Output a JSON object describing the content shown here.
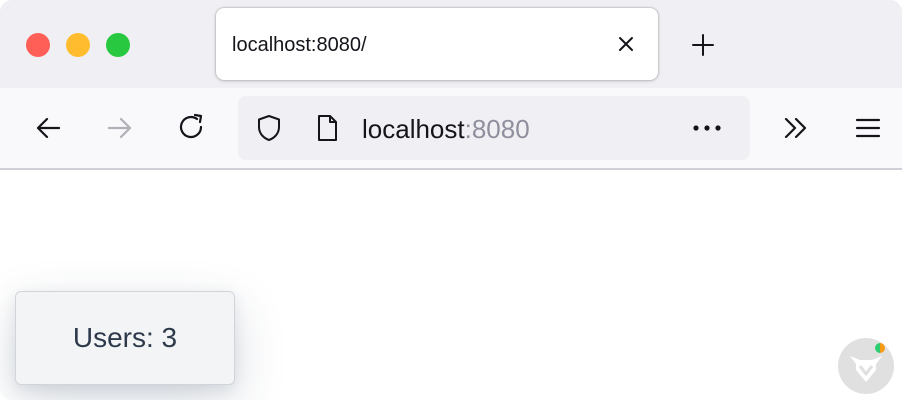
{
  "browser": {
    "tab": {
      "title": "localhost:8080/"
    },
    "urlbar": {
      "host": "localhost",
      "port": ":8080"
    },
    "icons": {
      "back": "arrow-left-icon",
      "forward": "arrow-right-icon",
      "reload": "reload-icon",
      "shield": "shield-icon",
      "page": "page-icon",
      "more": "more-horizontal-icon",
      "overflow": "double-chevron-right-icon",
      "menu": "hamburger-icon",
      "close_tab": "close-icon",
      "new_tab": "plus-icon"
    },
    "colors": {
      "traffic_close": "#ff5f57",
      "traffic_min": "#febc2e",
      "traffic_max": "#28c840"
    }
  },
  "page": {
    "users_card": {
      "text": "Users: 3"
    }
  }
}
